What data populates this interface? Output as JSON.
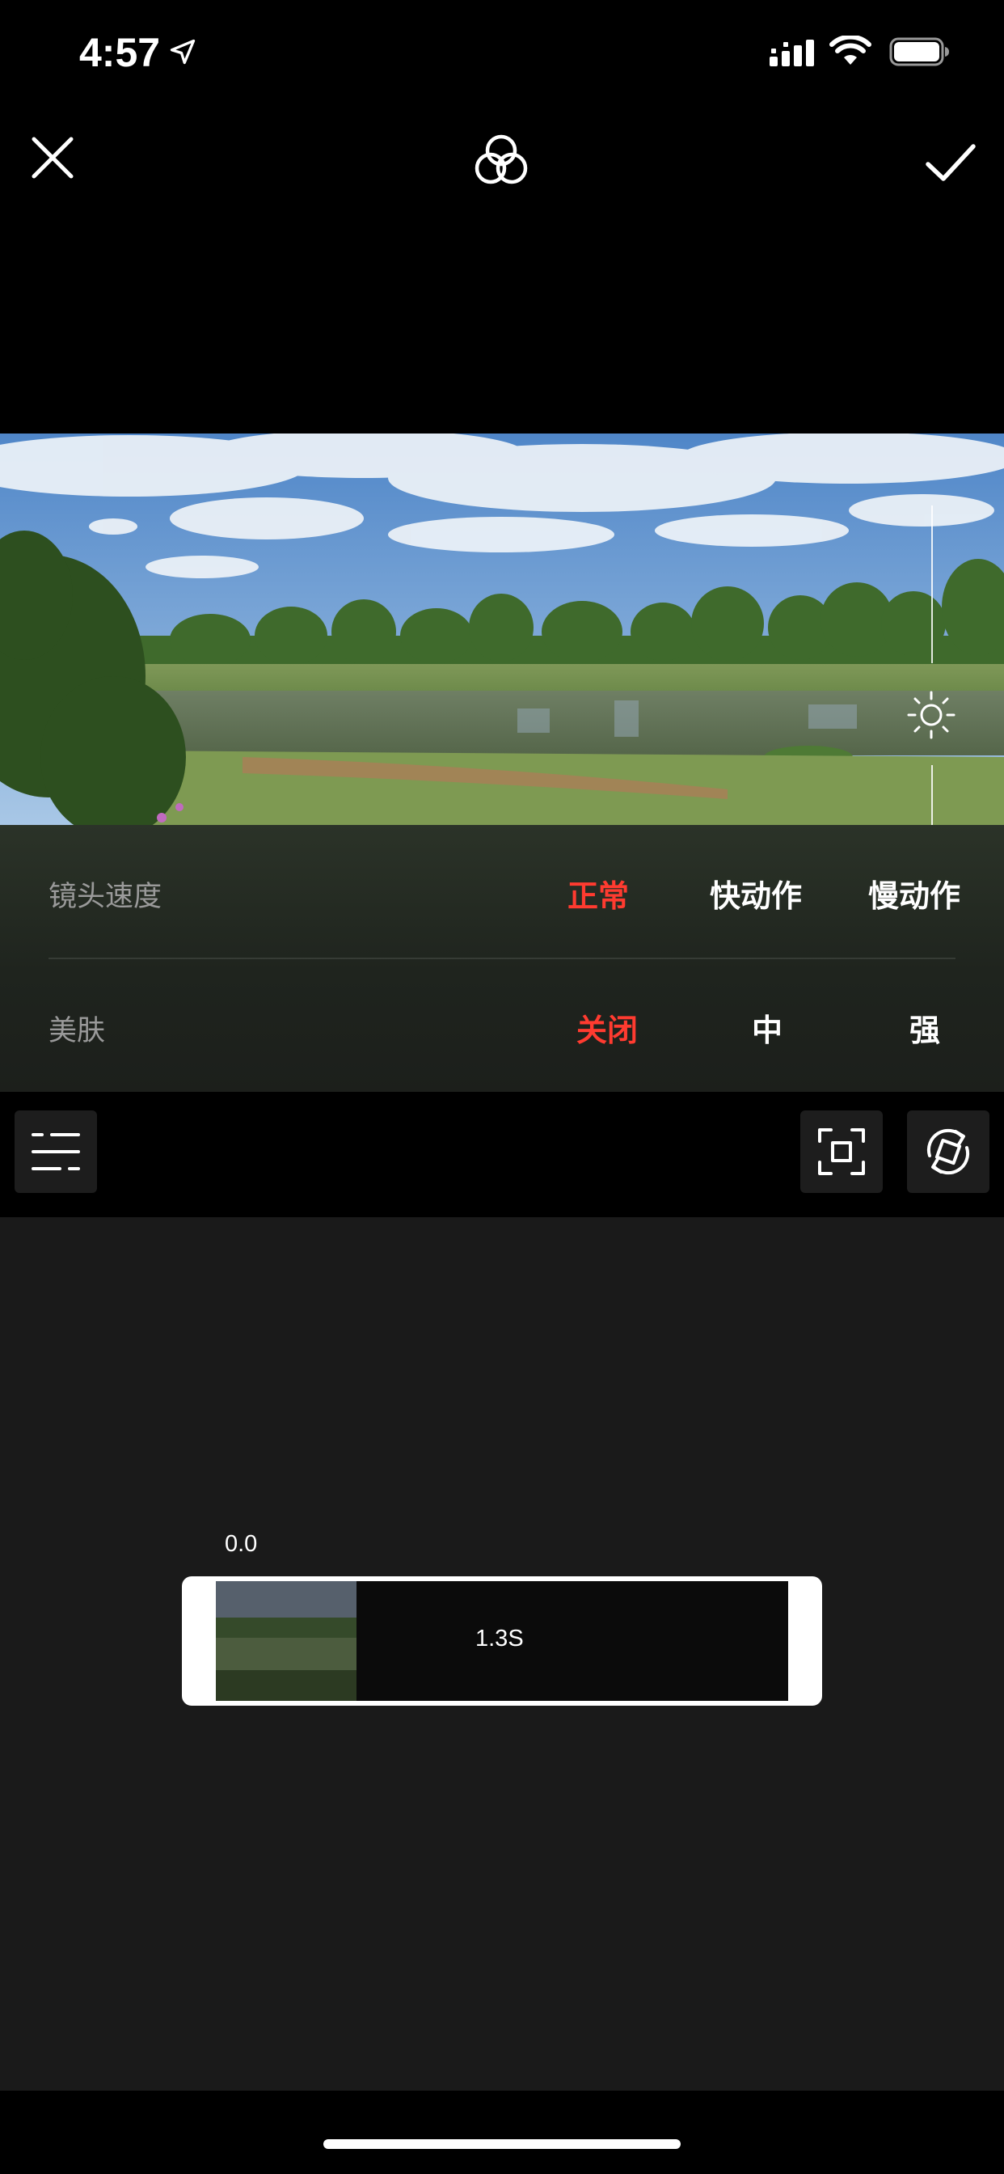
{
  "status_bar": {
    "time": "4:57",
    "location_icon": "location-arrow-icon",
    "signal_icon": "cellular-signal-icon",
    "wifi_icon": "wifi-icon",
    "battery_icon": "battery-icon"
  },
  "top_bar": {
    "close_icon": "close-icon",
    "filter_icon": "filter-circles-icon",
    "confirm_icon": "checkmark-icon"
  },
  "preview": {
    "exposure_icon": "sun-icon"
  },
  "settings": {
    "speed": {
      "label": "镜头速度",
      "options": [
        "正常",
        "快动作",
        "慢动作"
      ],
      "selected": "正常"
    },
    "beauty": {
      "label": "美肤",
      "options": [
        "关闭",
        "中",
        "强"
      ],
      "selected": "关闭"
    }
  },
  "tools": {
    "menu_icon": "settings-list-icon",
    "crop_icon": "crop-fullscreen-icon",
    "rotate_icon": "camera-switch-icon"
  },
  "timeline": {
    "start_time": "0.0",
    "clip_duration": "1.3S"
  },
  "colors": {
    "accent": "#ff3b30",
    "background": "#000000",
    "timeline_bg": "#1a1a1a",
    "panel_bg": "#232a21"
  }
}
